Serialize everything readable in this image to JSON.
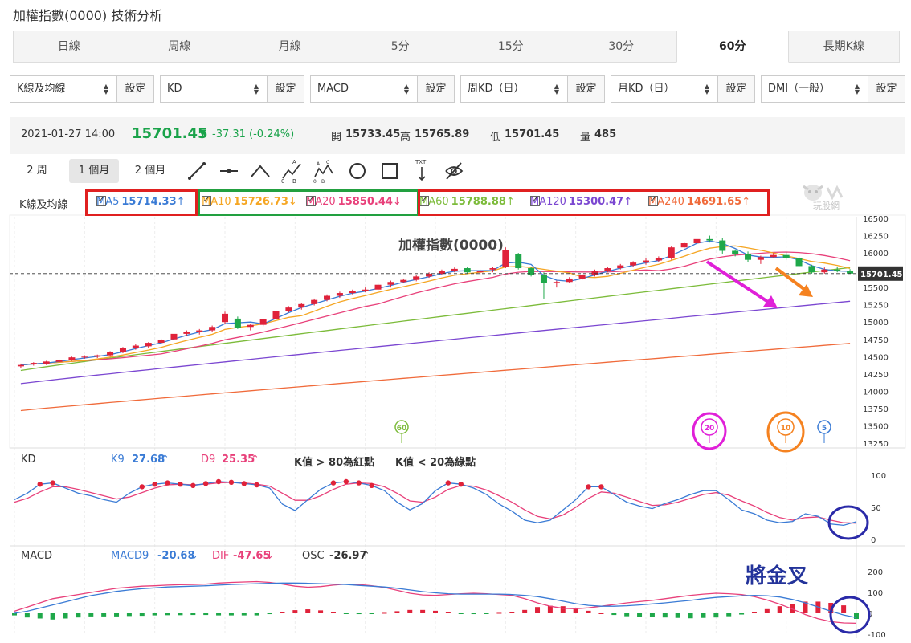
{
  "title": "加權指數(0000) 技術分析",
  "tabs": [
    "日線",
    "周線",
    "月線",
    "5分",
    "15分",
    "30分",
    "60分",
    "長期K線"
  ],
  "active_tab": "60分",
  "selectors": [
    {
      "value": "K線及均線",
      "button": "設定"
    },
    {
      "value": "KD",
      "button": "設定"
    },
    {
      "value": "MACD",
      "button": "設定"
    },
    {
      "value": "周KD（日）",
      "button": "設定"
    },
    {
      "value": "月KD（日）",
      "button": "設定"
    },
    {
      "value": "DMI（一般）",
      "button": "設定"
    }
  ],
  "quote": {
    "datetime": "2021-01-27 14:00",
    "price": "15701.45",
    "change": "-37.31 (-0.24%)",
    "open_label": "開",
    "open": "15733.45",
    "high_label": "高",
    "high": "15765.89",
    "low_label": "低",
    "low": "15701.45",
    "vol_label": "量",
    "vol": "485"
  },
  "periods": [
    "2 周",
    "1 個月",
    "2 個月"
  ],
  "active_period": "1 個月",
  "tools": [
    "line-tool-icon",
    "horizontal-line-icon",
    "angle-tool-icon",
    "abc-pattern-icon",
    "abcd-pattern-icon",
    "circle-tool-icon",
    "rect-tool-icon",
    "text-tool-icon",
    "hide-icon"
  ],
  "text_tool_label": "TXT",
  "watermark": "玩股網",
  "legend": {
    "label": "K線及均線",
    "items": [
      {
        "name": "MA5",
        "value": "15714.33",
        "arrow": "↑",
        "color": "#3a7bd5"
      },
      {
        "name": "MA10",
        "value": "15726.73",
        "arrow": "↓",
        "color": "#f5a623"
      },
      {
        "name": "MA20",
        "value": "15850.44",
        "arrow": "↓",
        "color": "#e8407a"
      },
      {
        "name": "MA60",
        "value": "15788.88",
        "arrow": "↑",
        "color": "#7cbb3a"
      },
      {
        "name": "MA120",
        "value": "15300.47",
        "arrow": "↑",
        "color": "#7b47d1"
      },
      {
        "name": "MA240",
        "value": "14691.65",
        "arrow": "↑",
        "color": "#f06a3a"
      }
    ]
  },
  "chart_title": "加權指數(0000)",
  "price_tag": "15701.45",
  "markers": [
    "60",
    "20",
    "10",
    "5"
  ],
  "kd": {
    "label": "KD",
    "k_label": "K9",
    "k": "27.68",
    "k_arrow": "↑",
    "d_label": "D9",
    "d": "25.35",
    "d_arrow": "↑",
    "note1": "K值 > 80為紅點",
    "note2": "K值 < 20為綠點"
  },
  "macd": {
    "label": "MACD",
    "macd_label": "MACD9",
    "macd": "-20.68",
    "macd_arrow": "↓",
    "dif_label": "DIF",
    "dif": "-47.65",
    "dif_arrow": "↓",
    "osc_label": "OSC",
    "osc": "-26.97",
    "osc_arrow": "↑"
  },
  "annotation": "將金叉",
  "chart_data": [
    {
      "type": "candlestick",
      "title": "加權指數(0000)",
      "y_ticks": [
        16500,
        16250,
        16000,
        15750,
        15500,
        15250,
        15000,
        14750,
        14500,
        14250,
        14000,
        13750,
        13500,
        13250
      ],
      "ylim": [
        13250,
        16500
      ],
      "candles": [
        [
          14360,
          14400,
          14330,
          14380
        ],
        [
          14390,
          14420,
          14370,
          14410
        ],
        [
          14400,
          14440,
          14380,
          14430
        ],
        [
          14425,
          14460,
          14410,
          14450
        ],
        [
          14455,
          14500,
          14440,
          14490
        ],
        [
          14490,
          14520,
          14470,
          14500
        ],
        [
          14500,
          14530,
          14480,
          14520
        ],
        [
          14520,
          14580,
          14500,
          14570
        ],
        [
          14570,
          14640,
          14550,
          14620
        ],
        [
          14620,
          14680,
          14600,
          14660
        ],
        [
          14650,
          14710,
          14630,
          14700
        ],
        [
          14700,
          14760,
          14680,
          14740
        ],
        [
          14750,
          14850,
          14730,
          14830
        ],
        [
          14830,
          14880,
          14800,
          14860
        ],
        [
          14860,
          14900,
          14820,
          14880
        ],
        [
          14880,
          14950,
          14860,
          14930
        ],
        [
          15000,
          15150,
          14980,
          15120
        ],
        [
          15050,
          15080,
          14900,
          14920
        ],
        [
          14930,
          14980,
          14880,
          14960
        ],
        [
          14960,
          15050,
          14940,
          15040
        ],
        [
          15040,
          15180,
          15020,
          15160
        ],
        [
          15160,
          15230,
          15140,
          15210
        ],
        [
          15210,
          15280,
          15180,
          15260
        ],
        [
          15260,
          15340,
          15240,
          15320
        ],
        [
          15320,
          15400,
          15300,
          15380
        ],
        [
          15380,
          15440,
          15350,
          15420
        ],
        [
          15420,
          15470,
          15400,
          15450
        ],
        [
          15450,
          15500,
          15430,
          15470
        ],
        [
          15470,
          15560,
          15450,
          15540
        ],
        [
          15540,
          15600,
          15500,
          15580
        ],
        [
          15580,
          15630,
          15560,
          15610
        ],
        [
          15610,
          15680,
          15590,
          15660
        ],
        [
          15660,
          15720,
          15640,
          15700
        ],
        [
          15700,
          15760,
          15680,
          15740
        ],
        [
          15740,
          15790,
          15720,
          15770
        ],
        [
          15780,
          15800,
          15700,
          15720
        ],
        [
          15720,
          15760,
          15690,
          15740
        ],
        [
          15760,
          15800,
          15720,
          15780
        ],
        [
          15800,
          16080,
          15780,
          16040
        ],
        [
          15980,
          16000,
          15760,
          15780
        ],
        [
          15780,
          15800,
          15660,
          15680
        ],
        [
          15680,
          15720,
          15340,
          15560
        ],
        [
          15560,
          15600,
          15500,
          15580
        ],
        [
          15580,
          15650,
          15560,
          15630
        ],
        [
          15630,
          15700,
          15610,
          15680
        ],
        [
          15680,
          15760,
          15660,
          15740
        ],
        [
          15740,
          15800,
          15720,
          15780
        ],
        [
          15780,
          15840,
          15760,
          15820
        ],
        [
          15820,
          15880,
          15800,
          15860
        ],
        [
          15860,
          15920,
          15830,
          15890
        ],
        [
          15890,
          15950,
          15870,
          15920
        ],
        [
          15920,
          16100,
          15900,
          16080
        ],
        [
          16080,
          16160,
          16050,
          16140
        ],
        [
          16140,
          16230,
          16100,
          16200
        ],
        [
          16200,
          16250,
          16150,
          16180
        ],
        [
          16180,
          16220,
          15990,
          16030
        ],
        [
          16030,
          16050,
          15950,
          15980
        ],
        [
          15980,
          16020,
          15870,
          15900
        ],
        [
          15900,
          15960,
          15840,
          15940
        ],
        [
          15940,
          16000,
          15920,
          15970
        ],
        [
          15970,
          16010,
          15900,
          15920
        ],
        [
          15920,
          15960,
          15790,
          15810
        ],
        [
          15810,
          15830,
          15700,
          15720
        ],
        [
          15720,
          15790,
          15700,
          15760
        ],
        [
          15760,
          15800,
          15720,
          15740
        ],
        [
          15733.45,
          15765.89,
          15701.45,
          15701.45
        ]
      ],
      "series": [
        {
          "name": "MA5"
        },
        {
          "name": "MA10"
        },
        {
          "name": "MA20"
        },
        {
          "name": "MA60"
        },
        {
          "name": "MA120"
        },
        {
          "name": "MA240"
        }
      ]
    },
    {
      "type": "line",
      "title": "KD",
      "y_ticks": [
        100,
        50,
        0
      ],
      "ylim": [
        0,
        100
      ],
      "series": [
        {
          "name": "K9",
          "values": [
            62,
            72,
            86,
            88,
            80,
            72,
            68,
            62,
            58,
            72,
            82,
            86,
            88,
            86,
            84,
            87,
            90,
            89,
            87,
            85,
            80,
            55,
            45,
            62,
            78,
            88,
            90,
            88,
            84,
            76,
            58,
            46,
            56,
            76,
            88,
            86,
            80,
            70,
            55,
            44,
            30,
            26,
            30,
            46,
            62,
            82,
            82,
            70,
            58,
            52,
            48,
            56,
            62,
            70,
            76,
            76,
            62,
            46,
            40,
            30,
            26,
            28,
            40,
            36,
            24,
            22,
            27.68
          ]
        },
        {
          "name": "D9",
          "values": [
            58,
            64,
            74,
            82,
            82,
            78,
            73,
            68,
            63,
            66,
            73,
            80,
            85,
            86,
            85,
            86,
            88,
            89,
            88,
            86,
            83,
            72,
            61,
            61,
            68,
            78,
            86,
            88,
            87,
            82,
            72,
            60,
            58,
            66,
            78,
            84,
            83,
            77,
            68,
            58,
            46,
            36,
            32,
            38,
            50,
            64,
            74,
            72,
            66,
            59,
            53,
            54,
            58,
            64,
            70,
            73,
            69,
            60,
            52,
            42,
            34,
            30,
            34,
            35,
            30,
            26,
            25.35
          ]
        }
      ]
    },
    {
      "type": "bar+line",
      "title": "MACD",
      "y_ticks": [
        200,
        100,
        0,
        -100
      ],
      "ylim": [
        -100,
        200
      ],
      "series": [
        {
          "name": "MACD9",
          "values": [
            0,
            10,
            25,
            40,
            55,
            70,
            85,
            95,
            105,
            112,
            118,
            122,
            126,
            128,
            130,
            132,
            135,
            138,
            140,
            142,
            144,
            145,
            145,
            144,
            142,
            140,
            138,
            134,
            130,
            126,
            120,
            112,
            104,
            98,
            94,
            92,
            92,
            92,
            92,
            90,
            86,
            80,
            70,
            58,
            46,
            38,
            34,
            34,
            36,
            40,
            45,
            50,
            56,
            62,
            70,
            76,
            80,
            84,
            86,
            84,
            78,
            66,
            50,
            30,
            10,
            -8,
            -20.68
          ]
        },
        {
          "name": "DIF",
          "values": [
            10,
            30,
            50,
            70,
            80,
            90,
            100,
            110,
            120,
            125,
            130,
            132,
            135,
            137,
            138,
            140,
            145,
            148,
            150,
            152,
            148,
            140,
            130,
            125,
            128,
            135,
            140,
            138,
            132,
            124,
            110,
            96,
            88,
            86,
            90,
            94,
            96,
            94,
            90,
            86,
            70,
            50,
            34,
            24,
            22,
            26,
            34,
            42,
            50,
            56,
            62,
            70,
            78,
            86,
            92,
            96,
            94,
            90,
            80,
            64,
            44,
            20,
            -6,
            -26,
            -40,
            -46,
            -47.65
          ]
        },
        {
          "name": "OSC",
          "values": [
            -10,
            -20,
            -25,
            -30,
            -25,
            -20,
            -15,
            -15,
            -15,
            -13,
            -12,
            -10,
            -9,
            -9,
            -8,
            -8,
            -10,
            -10,
            -10,
            -10,
            -4,
            5,
            15,
            19,
            14,
            5,
            -2,
            -4,
            -2,
            2,
            10,
            16,
            16,
            12,
            4,
            -2,
            -4,
            -2,
            2,
            4,
            16,
            30,
            36,
            34,
            24,
            12,
            0,
            -8,
            -14,
            -16,
            -17,
            -20,
            -22,
            -24,
            -22,
            -20,
            -14,
            -6,
            6,
            20,
            34,
            46,
            56,
            56,
            50,
            38,
            -26.97
          ]
        }
      ]
    }
  ]
}
